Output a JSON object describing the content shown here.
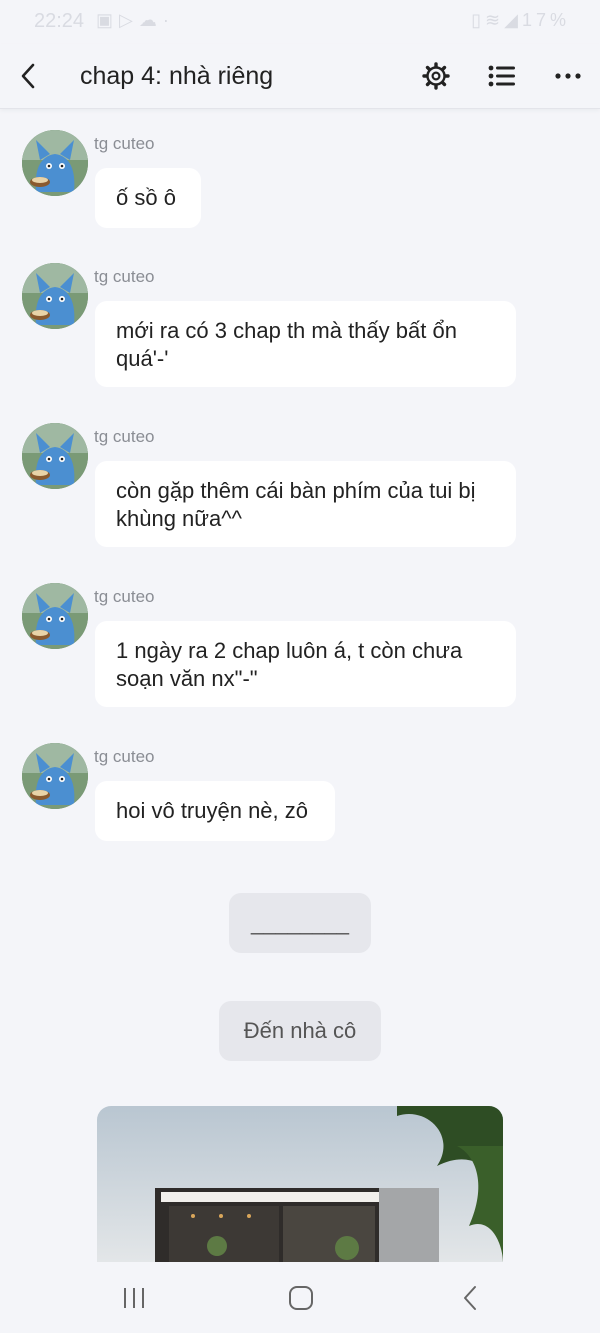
{
  "status_bar": {
    "time": "22:24",
    "battery": "17%",
    "icons": [
      "image-icon",
      "play-icon",
      "cloud-icon",
      "wifi-icon",
      "call-icon",
      "signal-icon",
      "battery-icon"
    ]
  },
  "header": {
    "title": "chap 4: nhà riêng"
  },
  "messages": [
    {
      "author": "tg cuteo",
      "text": "ố sồ ô"
    },
    {
      "author": "tg cuteo",
      "text": "mới ra có 3 chap th mà thấy bất ổn quá'-'"
    },
    {
      "author": "tg cuteo",
      "text": "còn gặp thêm cái bàn phím của tui bị khùng nữa^^"
    },
    {
      "author": "tg cuteo",
      "text": "1 ngày ra 2 chap luôn á, t còn chưa soạn văn nx\"-\""
    },
    {
      "author": "tg cuteo",
      "text": "hoi vô truyện nè, zô"
    }
  ],
  "separator": "________",
  "scene_label": "Đến nhà cô",
  "colors": {
    "background": "#f4f5f9",
    "bubble": "#ffffff",
    "pill": "#e6e7ec"
  }
}
